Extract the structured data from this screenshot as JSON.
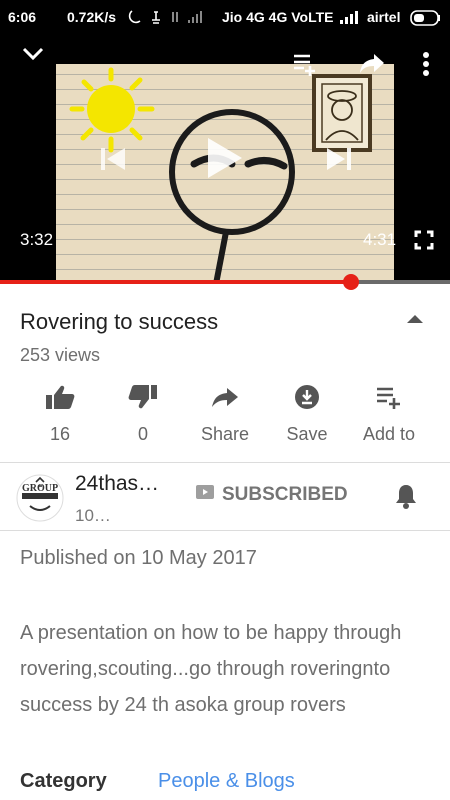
{
  "status_bar": {
    "time": "6:06",
    "speed": "0.72K/s",
    "carrier1": "Jio 4G 4G VoLTE",
    "carrier2": "airtel"
  },
  "player": {
    "current_time": "3:32",
    "duration": "4:31",
    "progress_fraction": 0.78
  },
  "video": {
    "title": "Rovering to success",
    "views": "253 views"
  },
  "actions": [
    {
      "label": "16",
      "icon": "thumbs-up-icon"
    },
    {
      "label": "0",
      "icon": "thumbs-down-icon"
    },
    {
      "label": "Share",
      "icon": "share-icon"
    },
    {
      "label": "Save",
      "icon": "download-icon"
    },
    {
      "label": "Add to",
      "icon": "playlist-add-icon"
    }
  ],
  "channel": {
    "name": "24thas…",
    "subscribers": "10…",
    "subscribe_label": "SUBSCRIBED",
    "avatar_text": "GROUP"
  },
  "description": {
    "published": "Published on 10 May 2017",
    "text": "A presentation on how to be happy through rovering,scouting...go through roveringnto success by 24 th asoka group rovers",
    "category_label": "Category",
    "category_value": "People & Blogs"
  },
  "colors": {
    "accent": "#e62117",
    "link": "#4a8fe8",
    "status_bar": "#000000"
  }
}
